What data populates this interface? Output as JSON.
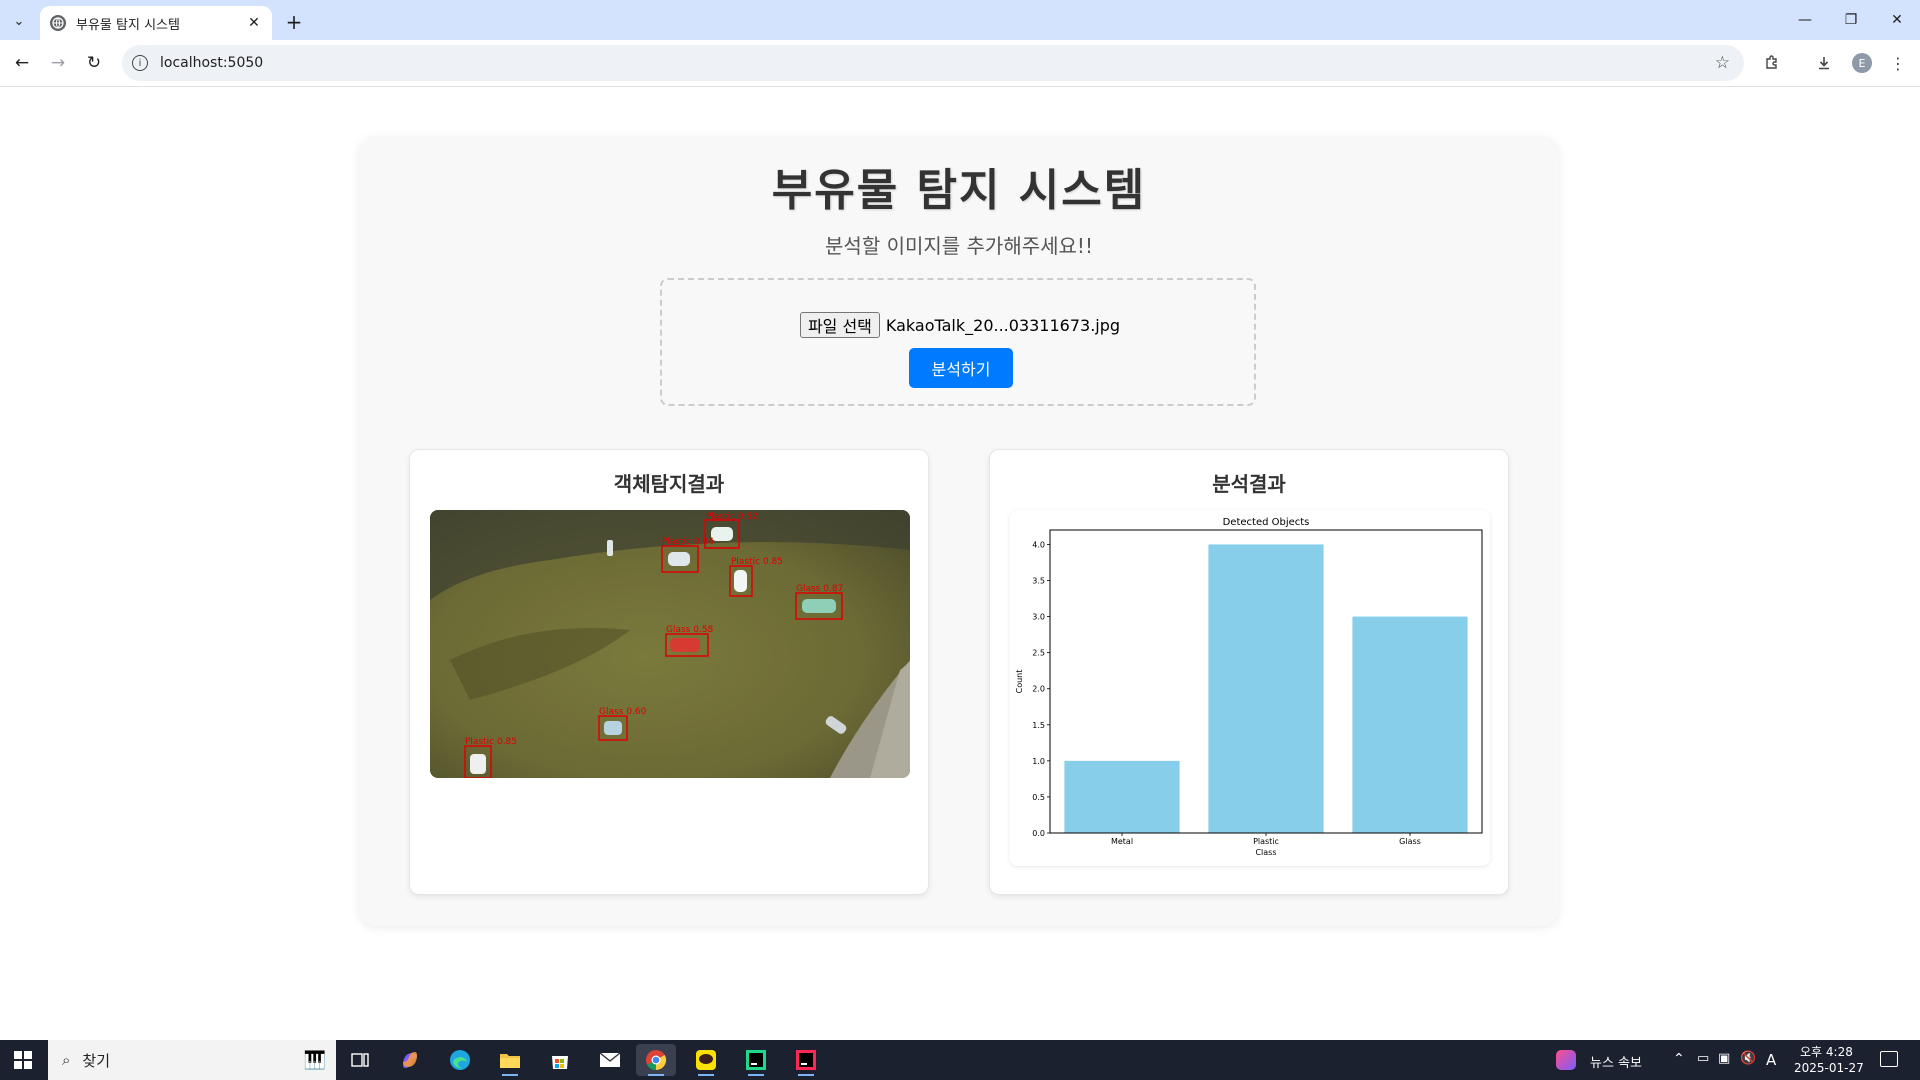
{
  "browser": {
    "tab_title": "부유물 탐지 시스템",
    "url": "localhost:5050",
    "profile_initial": "E"
  },
  "page": {
    "title": "부유물 탐지 시스템",
    "subtitle": "분석할 이미지를 추가해주세요!!",
    "file_button_label": "파일 선택",
    "file_name": "KakaoTalk_20...03311673.jpg",
    "analyze_button_label": "분석하기",
    "detection_card_title": "객체탐지결과",
    "analysis_card_title": "분석결과",
    "accent_color": "#007bff"
  },
  "detections": [
    {
      "label": "Plastic",
      "score": "0.52"
    },
    {
      "label": "Plastic",
      "score": "0.84"
    },
    {
      "label": "Plastic",
      "score": "0.85"
    },
    {
      "label": "Glass",
      "score": "0.87"
    },
    {
      "label": "Glass",
      "score": "0.58"
    },
    {
      "label": "Glass",
      "score": "0.60"
    },
    {
      "label": "Plastic",
      "score": "0.85"
    }
  ],
  "chart_data": {
    "type": "bar",
    "title": "Detected Objects",
    "xlabel": "Class",
    "ylabel": "Count",
    "categories": [
      "Metal",
      "Plastic",
      "Glass"
    ],
    "values": [
      1,
      4,
      3
    ],
    "ylim": [
      0,
      4.2
    ],
    "yticks": [
      "0.0",
      "0.5",
      "1.0",
      "1.5",
      "2.0",
      "2.5",
      "3.0",
      "3.5",
      "4.0"
    ],
    "bar_color": "#87ceeb",
    "grid": false
  },
  "taskbar": {
    "search_label": "찾기",
    "news_label": "뉴스 속보",
    "time": "오후 4:28",
    "date": "2025-01-27",
    "ime": "A"
  }
}
